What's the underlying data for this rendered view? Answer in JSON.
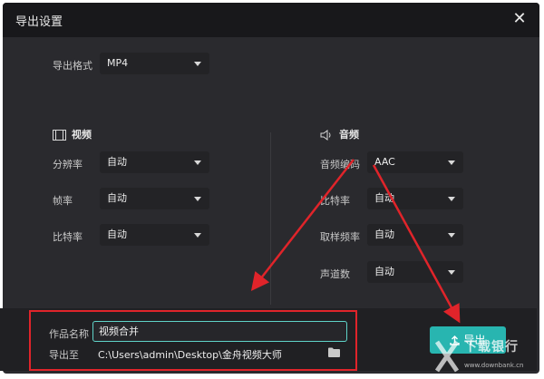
{
  "dialog": {
    "title": "导出设置",
    "close_glyph": "✕"
  },
  "format": {
    "label": "导出格式",
    "value": "MP4"
  },
  "video": {
    "heading": "视频",
    "icon": "film-icon",
    "resolution_label": "分辨率",
    "resolution_value": "自动",
    "framerate_label": "帧率",
    "framerate_value": "自动",
    "bitrate_label": "比特率",
    "bitrate_value": "自动"
  },
  "audio": {
    "heading": "音频",
    "icon": "speaker-icon",
    "codec_label": "音频编码",
    "codec_value": "AAC",
    "bitrate_label": "比特率",
    "bitrate_value": "自动",
    "samplerate_label": "取样频率",
    "samplerate_value": "自动",
    "channels_label": "声道数",
    "channels_value": "自动"
  },
  "footer": {
    "name_label": "作品名称",
    "name_value": "视频合并",
    "path_label": "导出至",
    "path_value": "C:\\Users\\admin\\Desktop\\金舟视频大师",
    "folder_icon": "folder-icon",
    "export_label": "导出"
  },
  "watermark": {
    "text": "下载银行",
    "url": "www.downbank.cn"
  },
  "colors": {
    "accent": "#28b5b0",
    "annotation": "#e0242a",
    "dialog_bg": "#2a2a2e"
  }
}
